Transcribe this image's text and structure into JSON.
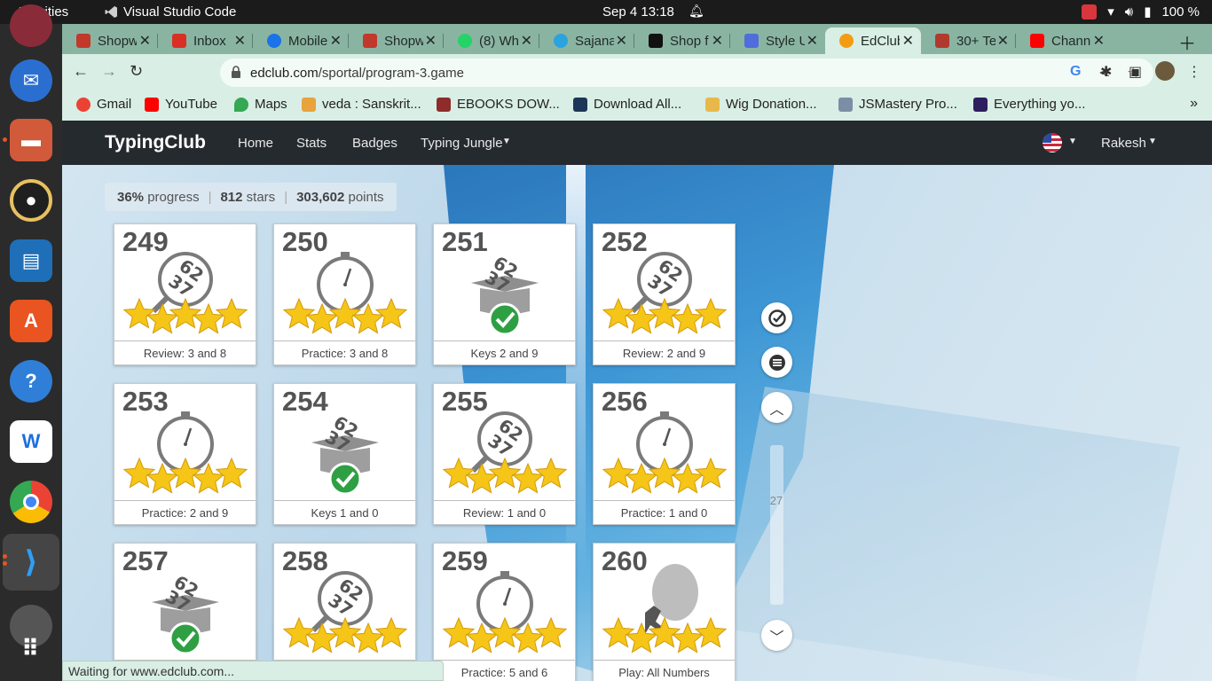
{
  "system_bar": {
    "activities": "Activities",
    "app_name": "Visual Studio Code",
    "clock": "Sep 4  13:18",
    "battery": "100 %"
  },
  "browser": {
    "tabs": [
      {
        "label": "Shopw",
        "color": "#c0392b"
      },
      {
        "label": "Inbox",
        "color": "#d93025"
      },
      {
        "label": "Mobile",
        "color": "#1a73e8"
      },
      {
        "label": "Shopw",
        "color": "#c0392b"
      },
      {
        "label": "(8) Wh",
        "color": "#25d366"
      },
      {
        "label": "Sajana",
        "color": "#2aa3df"
      },
      {
        "label": "Shop f",
        "color": "#111111"
      },
      {
        "label": "Style U",
        "color": "#4f6ddb"
      },
      {
        "label": "EdClub",
        "color": "#f39c12"
      },
      {
        "label": "30+ Te",
        "color": "#b03a2e"
      },
      {
        "label": "Chann",
        "color": "#ff0000"
      }
    ],
    "url_domain": "edclub.com",
    "url_path": "/sportal/program-3.game",
    "bookmarks": [
      {
        "label": "Gmail",
        "color": "#ea4335"
      },
      {
        "label": "YouTube",
        "color": "#ff0000"
      },
      {
        "label": "Maps",
        "color": "#34a853"
      },
      {
        "label": "veda : Sanskrit...",
        "color": "#e8a33d"
      },
      {
        "label": "EBOOKS DOW...",
        "color": "#8e2b2b"
      },
      {
        "label": "Download All...",
        "color": "#1d3557"
      },
      {
        "label": "Wig Donation...",
        "color": "#e9b84a"
      },
      {
        "label": "JSMastery Pro...",
        "color": "#7c8da6"
      },
      {
        "label": "Everything yo...",
        "color": "#2d1f5e"
      }
    ],
    "status_text": "Waiting for www.edclub.com..."
  },
  "site": {
    "brand": "TypingClub",
    "nav": [
      "Home",
      "Stats",
      "Badges",
      "Typing Jungle"
    ],
    "user": "Rakesh",
    "progress": {
      "percent": "36%",
      "percent_label": "progress",
      "stars": "812",
      "stars_label": "stars",
      "points": "303,602",
      "points_label": "points"
    },
    "scroll_index": "27"
  },
  "lessons": [
    {
      "num": "249",
      "label": "Review: 3 and 8",
      "icon": "magnifier",
      "stars": 5
    },
    {
      "num": "250",
      "label": "Practice: 3 and 8",
      "icon": "stopwatch",
      "stars": 5
    },
    {
      "num": "251",
      "label": "Keys 2 and 9",
      "icon": "box-check",
      "stars": 0
    },
    {
      "num": "252",
      "label": "Review: 2 and 9",
      "icon": "magnifier",
      "stars": 5
    },
    {
      "num": "253",
      "label": "Practice: 2 and 9",
      "icon": "stopwatch",
      "stars": 5
    },
    {
      "num": "254",
      "label": "Keys 1 and 0",
      "icon": "box-check",
      "stars": 0
    },
    {
      "num": "255",
      "label": "Review: 1 and 0",
      "icon": "magnifier",
      "stars": 5
    },
    {
      "num": "256",
      "label": "Practice: 1 and 0",
      "icon": "stopwatch",
      "stars": 5
    },
    {
      "num": "257",
      "label": "",
      "icon": "box-check",
      "stars": 0
    },
    {
      "num": "258",
      "label": "",
      "icon": "magnifier",
      "stars": 5
    },
    {
      "num": "259",
      "label": "Practice: 5 and 6",
      "icon": "stopwatch",
      "stars": 5
    },
    {
      "num": "260",
      "label": "Play: All Numbers",
      "icon": "balloon",
      "stars": 5
    }
  ],
  "colors": {
    "star": "#f5c518",
    "check": "#2ea043",
    "accent": "#252a2f"
  }
}
